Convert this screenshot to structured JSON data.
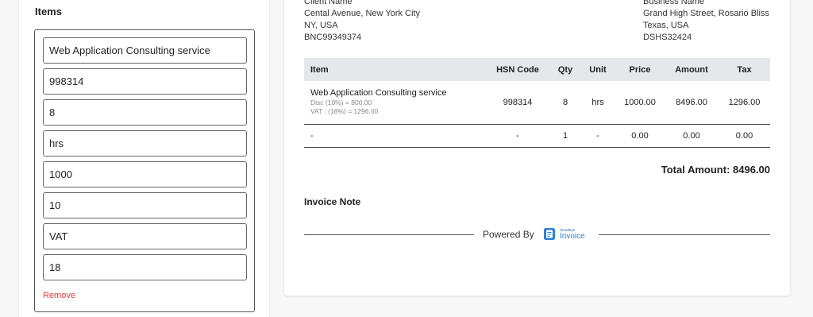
{
  "items_panel": {
    "heading": "Items",
    "fields": [
      {
        "name": "item-name-field",
        "value": "Web Application Consulting service"
      },
      {
        "name": "hsn-code-field",
        "value": "998314"
      },
      {
        "name": "quantity-field",
        "value": "8"
      },
      {
        "name": "unit-field",
        "value": "hrs"
      },
      {
        "name": "price-field",
        "value": "1000"
      },
      {
        "name": "discount-field",
        "value": "10"
      },
      {
        "name": "tax-name-field",
        "value": "VAT"
      },
      {
        "name": "tax-rate-field",
        "value": "18"
      }
    ],
    "remove_label": "Remove"
  },
  "invoice": {
    "client": {
      "label": "Client Name",
      "address": "Cental Avenue, New York City",
      "region": "NY, USA",
      "tax_id": "BNC99349374"
    },
    "business": {
      "label": "Business Name",
      "address": "Grand High Street, Rosario Bliss",
      "region": "Texas, USA",
      "tax_id": "DSHS32424"
    },
    "table": {
      "headers": [
        "Item",
        "HSN Code",
        "Qty",
        "Unit",
        "Price",
        "Amount",
        "Tax"
      ],
      "rows": [
        {
          "item": "Web Application Consulting service",
          "disc": "Disc (10%) = 800.00",
          "vat": "VAT : (18%) = 1296.00",
          "hsn": "998314",
          "qty": "8",
          "unit": "hrs",
          "price": "1000.00",
          "amount": "8496.00",
          "tax": "1296.00"
        },
        {
          "item": "-",
          "hsn": "-",
          "qty": "1",
          "unit": "-",
          "price": "0.00",
          "amount": "0.00",
          "tax": "0.00"
        }
      ]
    },
    "total": "Total Amount: 8496.00",
    "note_title": "Invoice Note",
    "powered_by": "Powered By",
    "logo": {
      "small_text": "Cloudtrys",
      "big_text": "Invoice"
    }
  },
  "colors": {
    "remove": "#e53935",
    "logo": "#2a7fd4",
    "table_header_bg": "#e6e7ea"
  }
}
